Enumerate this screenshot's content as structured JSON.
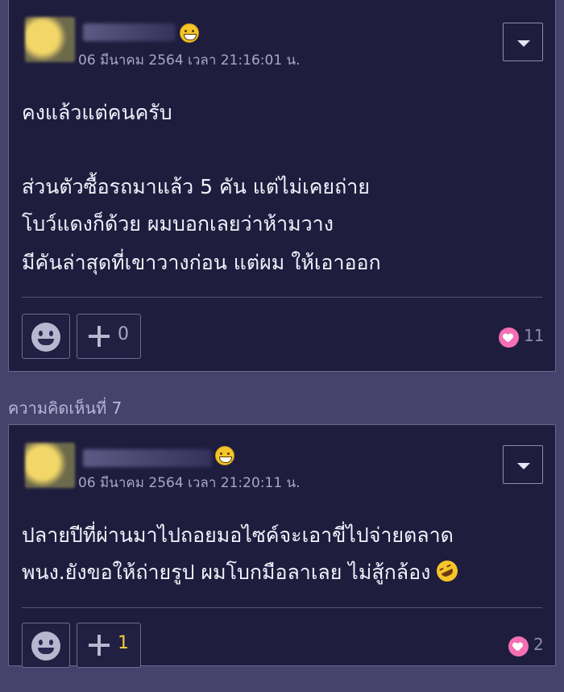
{
  "comments": [
    {
      "timestamp": "06 มีนาคม 2564 เวลา 21:16:01 น.",
      "lines": [
        "คงแล้วแต่คนครับ",
        "",
        "ส่วนตัวซื้อรถมาแล้ว 5 คัน แต่ไม่เคยถ่าย",
        "โบว์แดงก็ด้วย ผมบอกเลยว่าห้ามวาง",
        "มีคันล่าสุดที่เขาวางก่อน แต่ผม ให้เอาออก"
      ],
      "plus_count": "0",
      "like_count": "11",
      "badge_emoji": "grinning-face-icon"
    },
    {
      "header": "ความคิดเห็นที่ 7",
      "timestamp": "06 มีนาคม 2564 เวลา 21:20:11 น.",
      "lines": [
        "ปลายปีที่ผ่านมาไปถอยมอไซค์จะเอาขี่ไปจ่ายตลาด",
        "พนง.ยังขอให้ถ่ายรูป ผมโบกมือลาเลย ไม่สู้กล้อง"
      ],
      "plus_count": "1",
      "like_count": "2",
      "badge_emoji": "grinning-face-icon"
    }
  ],
  "colors": {
    "page_bg": "#47426b",
    "card_bg": "#1f1d3e",
    "heart": "#f46fb3",
    "plus_active": "#f3cf35"
  }
}
